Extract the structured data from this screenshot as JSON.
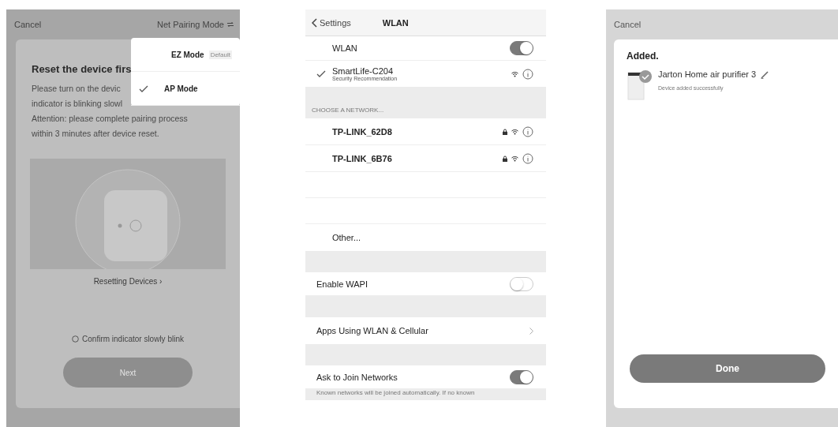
{
  "pairing_screen": {
    "cancel": "Cancel",
    "mode_menu_label": "Net Pairing Mode",
    "title": "Reset the device firs",
    "instructions": [
      "Please turn on the devic",
      "indicator is blinking slowl",
      "Attention: please complete pairing process",
      "within 3 minutes after device reset."
    ],
    "link": "Resetting Devices ›",
    "confirm": {
      "label": "Confirm indicator slowly blink",
      "checked": false
    },
    "next_button": {
      "label": "Next",
      "disabled": true
    },
    "mode_menu": [
      {
        "label": "EZ Mode",
        "badge": "Default",
        "selected": false
      },
      {
        "label": "AP Mode",
        "selected": true
      }
    ]
  },
  "wlan_screen": {
    "back": "Settings",
    "title": "WLAN",
    "rows": [
      {
        "kind": "toggle",
        "label": "WLAN",
        "on": true
      },
      {
        "kind": "connected",
        "name": "SmartLife-C204",
        "subtitle": "Security Recommendation",
        "selected": true
      },
      {
        "kind": "section",
        "label": "CHOOSE A NETWORK..."
      },
      {
        "kind": "network",
        "name": "TP-LINK_62D8",
        "locked": true
      },
      {
        "kind": "network",
        "name": "TP-LINK_6B76",
        "locked": true
      },
      {
        "kind": "blank"
      },
      {
        "kind": "blank"
      },
      {
        "kind": "plain",
        "label": "Other..."
      },
      {
        "kind": "gap"
      },
      {
        "kind": "toggle",
        "label": "Enable WAPI",
        "on": false
      },
      {
        "kind": "gap"
      },
      {
        "kind": "link",
        "label": "Apps Using WLAN & Cellular"
      },
      {
        "kind": "gap"
      },
      {
        "kind": "toggle",
        "label": "Ask to Join Networks",
        "on": true
      },
      {
        "kind": "note",
        "text": "Known networks will be joined automatically. If no known"
      }
    ]
  },
  "added_screen": {
    "cancel": "Cancel",
    "title": "Added.",
    "device": {
      "name": "Jarton Home air purifier 3",
      "status": "Device added successfully"
    },
    "done_button": "Done"
  }
}
